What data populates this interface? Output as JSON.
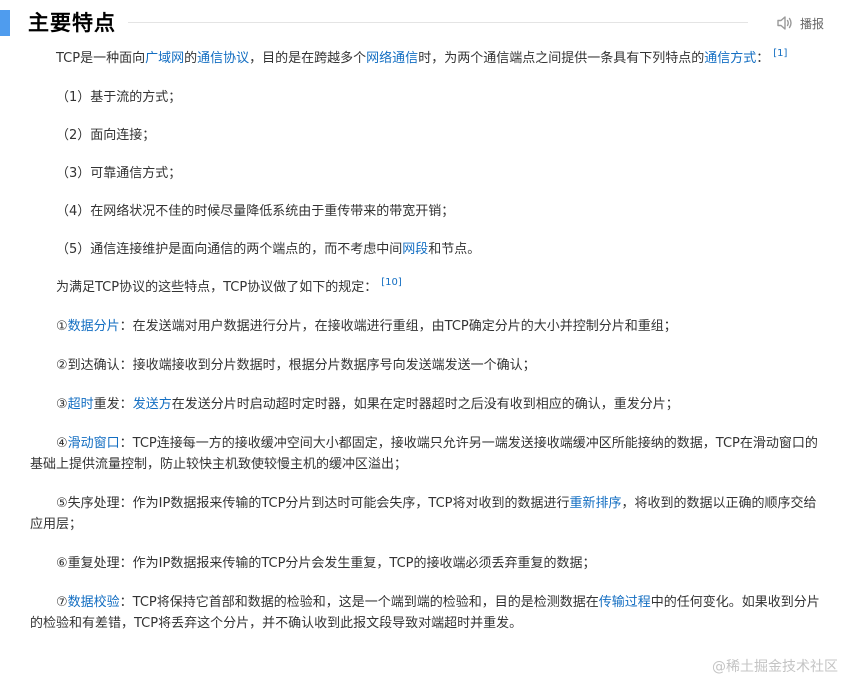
{
  "section": {
    "title": "主要特点",
    "audio_label": "播报"
  },
  "paragraphs": [
    {
      "class": "para",
      "segments": [
        {
          "t": "TCP是一种面向"
        },
        {
          "t": "广域网",
          "link": true
        },
        {
          "t": "的"
        },
        {
          "t": "通信协议",
          "link": true
        },
        {
          "t": "，目的是在跨越多个"
        },
        {
          "t": "网络通信",
          "link": true
        },
        {
          "t": "时，为两个通信端点之间提供一条具有下列特点的"
        },
        {
          "t": "通信方式",
          "link": true
        },
        {
          "t": "："
        },
        {
          "t": "[1]",
          "ref": true
        }
      ]
    },
    {
      "class": "para list",
      "segments": [
        {
          "t": "（1）基于流的方式；"
        }
      ]
    },
    {
      "class": "para list",
      "segments": [
        {
          "t": "（2）面向连接；"
        }
      ]
    },
    {
      "class": "para list",
      "segments": [
        {
          "t": "（3）可靠通信方式；"
        }
      ]
    },
    {
      "class": "para list",
      "segments": [
        {
          "t": "（4）在网络状况不佳的时候尽量降低系统由于重传带来的带宽开销；"
        }
      ]
    },
    {
      "class": "para list",
      "segments": [
        {
          "t": "（5）通信连接维护是面向通信的两个端点的，而不考虑中间"
        },
        {
          "t": "网段",
          "link": true
        },
        {
          "t": "和节点。"
        }
      ]
    },
    {
      "class": "para",
      "segments": [
        {
          "t": "为满足TCP协议的这些特点，TCP协议做了如下的规定："
        },
        {
          "t": "[10]",
          "ref": true
        }
      ]
    },
    {
      "class": "para",
      "segments": [
        {
          "t": "①"
        },
        {
          "t": "数据分片",
          "link": true
        },
        {
          "t": "：在发送端对用户数据进行分片，在接收端进行重组，由TCP确定分片的大小并控制分片和重组；"
        }
      ]
    },
    {
      "class": "para",
      "segments": [
        {
          "t": "②到达确认：接收端接收到分片数据时，根据分片数据序号向发送端发送一个确认；"
        }
      ]
    },
    {
      "class": "para",
      "segments": [
        {
          "t": "③"
        },
        {
          "t": "超时",
          "link": true
        },
        {
          "t": "重发："
        },
        {
          "t": "发送方",
          "link": true
        },
        {
          "t": "在发送分片时启动超时定时器，如果在定时器超时之后没有收到相应的确认，重发分片；"
        }
      ]
    },
    {
      "class": "para",
      "segments": [
        {
          "t": "④"
        },
        {
          "t": "滑动窗口",
          "link": true
        },
        {
          "t": "：TCP连接每一方的接收缓冲空间大小都固定，接收端只允许另一端发送接收端缓冲区所能接纳的数据，TCP在滑动窗口的基础上提供流量控制，防止较快主机致使较慢主机的缓冲区溢出；"
        }
      ]
    },
    {
      "class": "para",
      "segments": [
        {
          "t": "⑤失序处理：作为IP数据报来传输的TCP分片到达时可能会失序，TCP将对收到的数据进行"
        },
        {
          "t": "重新排序",
          "link": true
        },
        {
          "t": "，将收到的数据以正确的顺序交给应用层；"
        }
      ]
    },
    {
      "class": "para",
      "segments": [
        {
          "t": "⑥重复处理：作为IP数据报来传输的TCP分片会发生重复，TCP的接收端必须丢弃重复的数据；"
        }
      ]
    },
    {
      "class": "para",
      "segments": [
        {
          "t": "⑦"
        },
        {
          "t": "数据校验",
          "link": true
        },
        {
          "t": "：TCP将保持它首部和数据的检验和，这是一个端到端的检验和，目的是检测数据在"
        },
        {
          "t": "传输过程",
          "link": true
        },
        {
          "t": "中的任何变化。如果收到分片的检验和有差错，TCP将丢弃这个分片，并不确认收到此报文段导致对端超时并重发。"
        }
      ]
    }
  ],
  "watermark": "@稀土掘金技术社区",
  "colors": {
    "accent_bar": "#4f9cee",
    "link": "#136ec2",
    "text": "#333333"
  },
  "icons": {
    "audio": "speaker-icon"
  }
}
